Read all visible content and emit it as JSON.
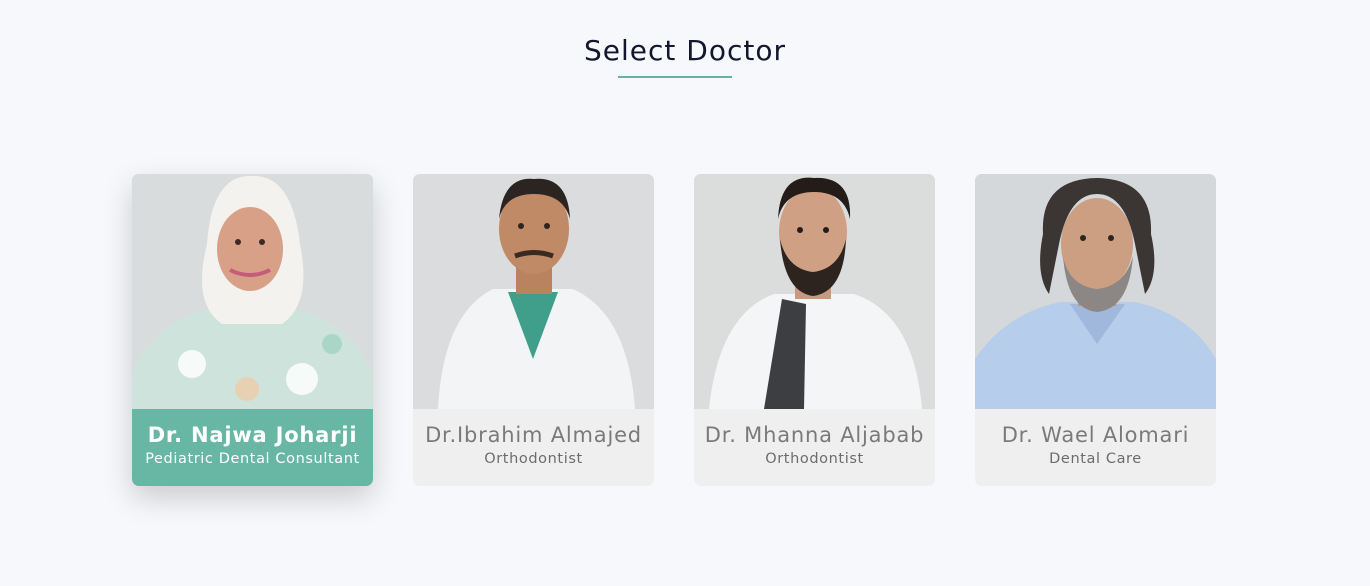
{
  "page": {
    "title": "Select Doctor"
  },
  "doctors": [
    {
      "name": "Dr. Najwa Joharji",
      "role": "Pediatric Dental Consultant",
      "selected": true
    },
    {
      "name": "Dr.Ibrahim Almajed",
      "role": "Orthodontist",
      "selected": false
    },
    {
      "name": "Dr. Mhanna Aljabab",
      "role": "Orthodontist",
      "selected": false
    },
    {
      "name": "Dr. Wael Alomari",
      "role": "Dental Care",
      "selected": false
    }
  ],
  "colors": {
    "accent": "#68b7a5",
    "title": "#14162e",
    "card_bg": "#efefef",
    "page_bg": "#f7f8fc"
  }
}
